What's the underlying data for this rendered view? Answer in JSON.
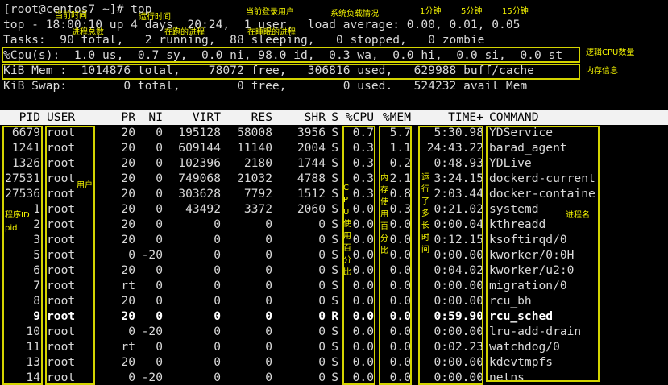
{
  "terminal": {
    "prompt": "[root@centos7 ~]# top",
    "summary": [
      "top - 18:00:10 up 4 days, 20:24,  1 user,  load average: 0.00, 0.01, 0.05",
      "Tasks:  90 total,   2 running,  88 sleeping,   0 stopped,   0 zombie",
      "%Cpu(s):  1.0 us,  0.7 sy,  0.0 ni, 98.0 id,  0.3 wa,  0.0 hi,  0.0 si,  0.0 st",
      "KiB Mem :  1014876 total,    78072 free,   306816 used,   629988 buff/cache",
      "KiB Swap:        0 total,        0 free,        0 used.   524232 avail Mem"
    ],
    "columns": [
      "PID",
      "USER",
      "PR",
      "NI",
      "VIRT",
      "RES",
      "SHR",
      "S",
      "%CPU",
      "%MEM",
      "TIME+",
      "COMMAND"
    ],
    "processes": [
      {
        "pid": "6679",
        "user": "root",
        "pr": "20",
        "ni": "0",
        "virt": "195128",
        "res": "58008",
        "shr": "3956",
        "s": "S",
        "cpu": "0.7",
        "mem": "5.7",
        "time": "5:30.98",
        "cmd": "YDService",
        "bold": false
      },
      {
        "pid": "1241",
        "user": "root",
        "pr": "20",
        "ni": "0",
        "virt": "609144",
        "res": "11140",
        "shr": "2004",
        "s": "S",
        "cpu": "0.3",
        "mem": "1.1",
        "time": "24:43.22",
        "cmd": "barad_agent",
        "bold": false
      },
      {
        "pid": "1326",
        "user": "root",
        "pr": "20",
        "ni": "0",
        "virt": "102396",
        "res": "2180",
        "shr": "1744",
        "s": "S",
        "cpu": "0.3",
        "mem": "0.2",
        "time": "0:48.93",
        "cmd": "YDLive",
        "bold": false
      },
      {
        "pid": "27531",
        "user": "root",
        "pr": "20",
        "ni": "0",
        "virt": "749068",
        "res": "21032",
        "shr": "4788",
        "s": "S",
        "cpu": "0.3",
        "mem": "2.1",
        "time": "3:24.15",
        "cmd": "dockerd-current",
        "bold": false
      },
      {
        "pid": "27536",
        "user": "root",
        "pr": "20",
        "ni": "0",
        "virt": "303628",
        "res": "7792",
        "shr": "1512",
        "s": "S",
        "cpu": "0.3",
        "mem": "0.8",
        "time": "2:03.44",
        "cmd": "docker-containe",
        "bold": false
      },
      {
        "pid": "1",
        "user": "root",
        "pr": "20",
        "ni": "0",
        "virt": "43492",
        "res": "3372",
        "shr": "2060",
        "s": "S",
        "cpu": "0.0",
        "mem": "0.3",
        "time": "0:21.02",
        "cmd": "systemd",
        "bold": false
      },
      {
        "pid": "2",
        "user": "root",
        "pr": "20",
        "ni": "0",
        "virt": "0",
        "res": "0",
        "shr": "0",
        "s": "S",
        "cpu": "0.0",
        "mem": "0.0",
        "time": "0:00.04",
        "cmd": "kthreadd",
        "bold": false
      },
      {
        "pid": "3",
        "user": "root",
        "pr": "20",
        "ni": "0",
        "virt": "0",
        "res": "0",
        "shr": "0",
        "s": "S",
        "cpu": "0.0",
        "mem": "0.0",
        "time": "0:12.15",
        "cmd": "ksoftirqd/0",
        "bold": false
      },
      {
        "pid": "5",
        "user": "root",
        "pr": "0",
        "ni": "-20",
        "virt": "0",
        "res": "0",
        "shr": "0",
        "s": "S",
        "cpu": "0.0",
        "mem": "0.0",
        "time": "0:00.00",
        "cmd": "kworker/0:0H",
        "bold": false
      },
      {
        "pid": "6",
        "user": "root",
        "pr": "20",
        "ni": "0",
        "virt": "0",
        "res": "0",
        "shr": "0",
        "s": "S",
        "cpu": "0.0",
        "mem": "0.0",
        "time": "0:04.02",
        "cmd": "kworker/u2:0",
        "bold": false
      },
      {
        "pid": "7",
        "user": "root",
        "pr": "rt",
        "ni": "0",
        "virt": "0",
        "res": "0",
        "shr": "0",
        "s": "S",
        "cpu": "0.0",
        "mem": "0.0",
        "time": "0:00.00",
        "cmd": "migration/0",
        "bold": false
      },
      {
        "pid": "8",
        "user": "root",
        "pr": "20",
        "ni": "0",
        "virt": "0",
        "res": "0",
        "shr": "0",
        "s": "S",
        "cpu": "0.0",
        "mem": "0.0",
        "time": "0:00.00",
        "cmd": "rcu_bh",
        "bold": false
      },
      {
        "pid": "9",
        "user": "root",
        "pr": "20",
        "ni": "0",
        "virt": "0",
        "res": "0",
        "shr": "0",
        "s": "R",
        "cpu": "0.0",
        "mem": "0.0",
        "time": "0:59.90",
        "cmd": "rcu_sched",
        "bold": true
      },
      {
        "pid": "10",
        "user": "root",
        "pr": "0",
        "ni": "-20",
        "virt": "0",
        "res": "0",
        "shr": "0",
        "s": "S",
        "cpu": "0.0",
        "mem": "0.0",
        "time": "0:00.00",
        "cmd": "lru-add-drain",
        "bold": false
      },
      {
        "pid": "11",
        "user": "root",
        "pr": "rt",
        "ni": "0",
        "virt": "0",
        "res": "0",
        "shr": "0",
        "s": "S",
        "cpu": "0.0",
        "mem": "0.0",
        "time": "0:02.23",
        "cmd": "watchdog/0",
        "bold": false
      },
      {
        "pid": "13",
        "user": "root",
        "pr": "20",
        "ni": "0",
        "virt": "0",
        "res": "0",
        "shr": "0",
        "s": "S",
        "cpu": "0.0",
        "mem": "0.0",
        "time": "0:00.00",
        "cmd": "kdevtmpfs",
        "bold": false
      },
      {
        "pid": "14",
        "user": "root",
        "pr": "0",
        "ni": "-20",
        "virt": "0",
        "res": "0",
        "shr": "0",
        "s": "S",
        "cpu": "0.0",
        "mem": "0.0",
        "time": "0:00.00",
        "cmd": "netns",
        "bold": false
      }
    ]
  },
  "annotations": {
    "current_time": "当前时间",
    "uptime": "运行时间",
    "current_users": "当前登录用户",
    "load_status": "系统负载情况",
    "min1": "1分钟",
    "min5": "5分钟",
    "min15": "15分钟",
    "total_procs": "进程总数",
    "running_procs": "在跑的进程",
    "sleeping_procs": "在睡眠的进程",
    "logical_cpu": "逻辑CPU数量",
    "memory_info": "内存信息",
    "user": "用户",
    "pid": "程序ID\npid",
    "cpu_usage": "CPU使用百分比",
    "mem_usage": "内存使用百分比",
    "run_time": "运行了多长时间",
    "process_name": "进程名"
  },
  "colors": {
    "annotation": "#f5f500",
    "box": "#d4d400",
    "text": "#d8d8d8",
    "header_bg": "#f2f2f2"
  }
}
